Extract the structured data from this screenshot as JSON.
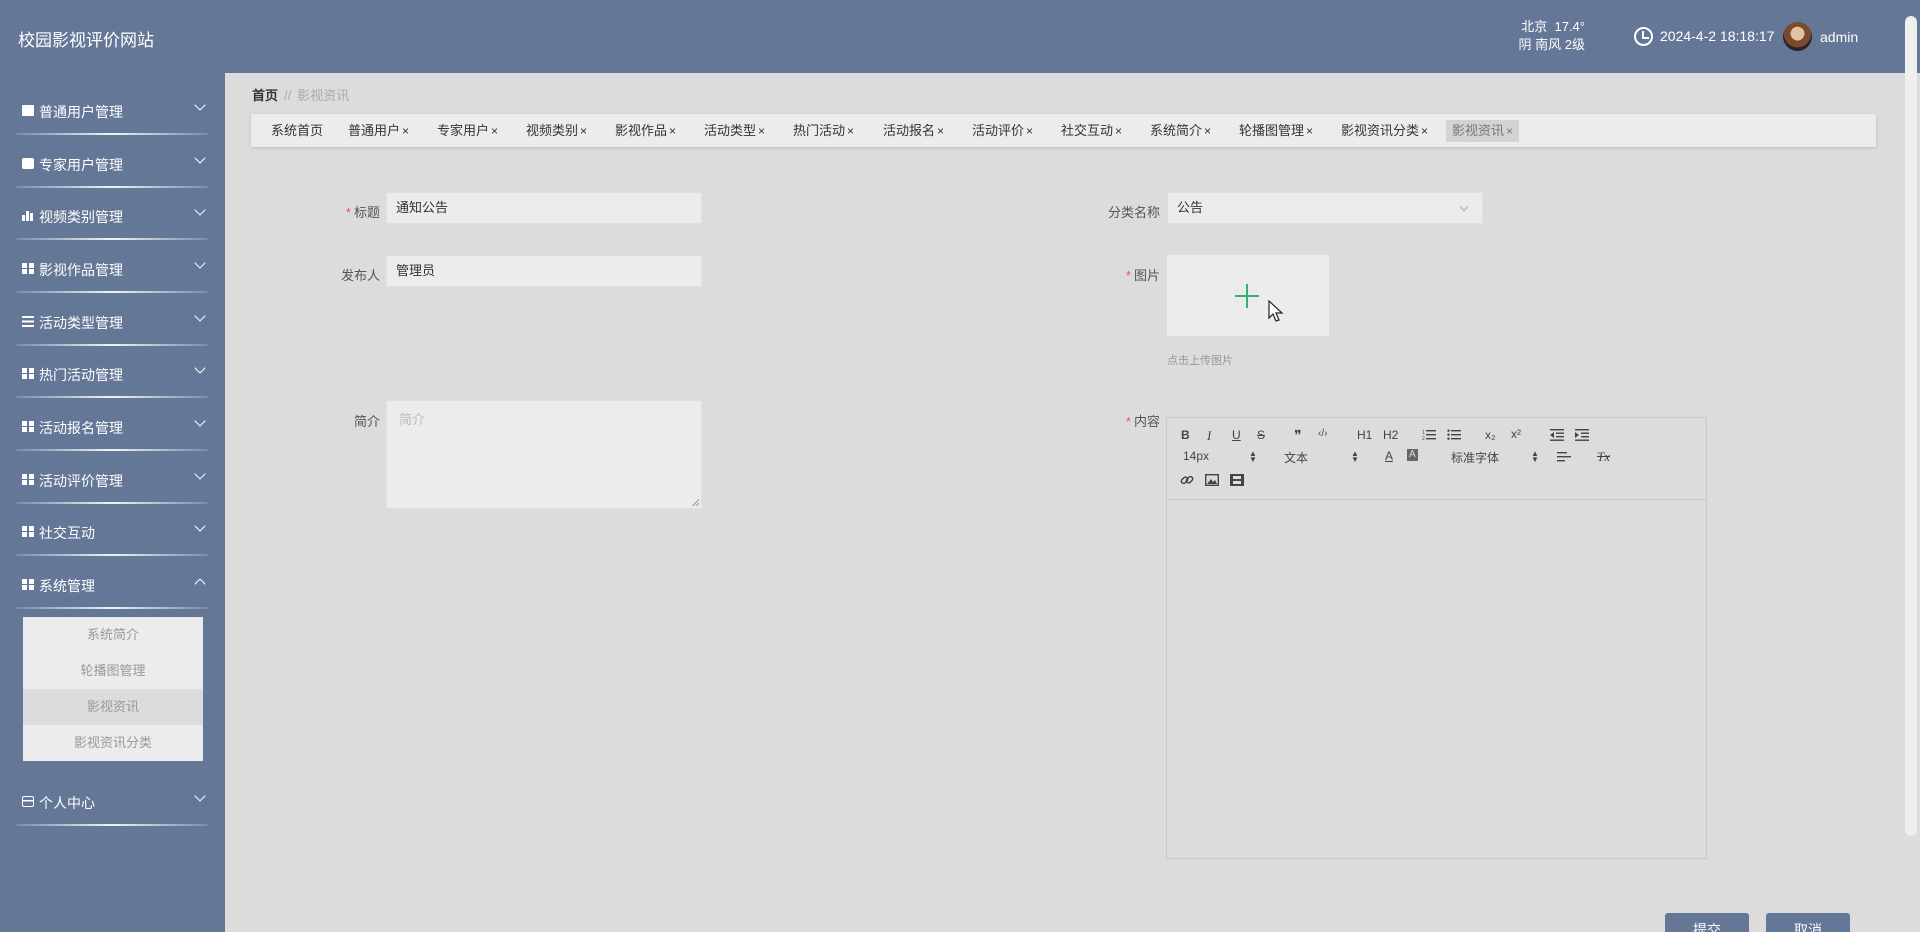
{
  "header": {
    "app_title": "校园影视评价网站",
    "weather": {
      "city": "北京",
      "temp": "17.4°",
      "desc": "阴 南风 2级"
    },
    "datetime": "2024-4-2 18:18:17",
    "user": "admin"
  },
  "sidebar": {
    "items": [
      {
        "label": "普通用户管理",
        "icon": "clipboard-icon"
      },
      {
        "label": "专家用户管理",
        "icon": "briefcase-icon"
      },
      {
        "label": "视频类别管理",
        "icon": "bar-chart-icon"
      },
      {
        "label": "影视作品管理",
        "icon": "grid-icon"
      },
      {
        "label": "活动类型管理",
        "icon": "list-icon"
      },
      {
        "label": "热门活动管理",
        "icon": "grid-icon"
      },
      {
        "label": "活动报名管理",
        "icon": "grid-icon"
      },
      {
        "label": "活动评价管理",
        "icon": "grid-icon"
      },
      {
        "label": "社交互动",
        "icon": "grid-icon"
      },
      {
        "label": "系统管理",
        "icon": "grid-icon",
        "expanded": true
      },
      {
        "label": "个人中心",
        "icon": "card-icon"
      }
    ],
    "submenu": [
      "系统简介",
      "轮播图管理",
      "影视资讯",
      "影视资讯分类"
    ],
    "active_submenu": "影视资讯"
  },
  "breadcrumb": {
    "home": "首页",
    "separator": "//",
    "current": "影视资讯"
  },
  "tabs": [
    {
      "label": "系统首页",
      "closable": false
    },
    {
      "label": "普通用户",
      "closable": true
    },
    {
      "label": "专家用户",
      "closable": true
    },
    {
      "label": "视频类别",
      "closable": true
    },
    {
      "label": "影视作品",
      "closable": true
    },
    {
      "label": "活动类型",
      "closable": true
    },
    {
      "label": "热门活动",
      "closable": true
    },
    {
      "label": "活动报名",
      "closable": true
    },
    {
      "label": "活动评价",
      "closable": true
    },
    {
      "label": "社交互动",
      "closable": true
    },
    {
      "label": "系统简介",
      "closable": true
    },
    {
      "label": "轮播图管理",
      "closable": true
    },
    {
      "label": "影视资讯分类",
      "closable": true
    },
    {
      "label": "影视资讯",
      "closable": true,
      "active": true
    }
  ],
  "tab_close_glyph": "×",
  "form": {
    "title": {
      "label": "标题",
      "value": "通知公告",
      "required": true
    },
    "category": {
      "label": "分类名称",
      "value": "公告"
    },
    "publisher": {
      "label": "发布人",
      "value": "管理员"
    },
    "image": {
      "label": "图片",
      "hint": "点击上传图片",
      "required": true
    },
    "summary": {
      "label": "简介",
      "placeholder": "简介"
    },
    "content": {
      "label": "内容",
      "required": true
    },
    "required_mark": "*"
  },
  "editor": {
    "toolbar_row1": [
      "B",
      "I",
      "U",
      "S",
      "❞",
      "‹/›",
      "H1",
      "H2",
      "ordered-list",
      "bullet-list",
      "x₂",
      "x²",
      "outdent",
      "indent"
    ],
    "font_size": "14px",
    "header_select": "文本",
    "text_color_glyph": "A",
    "font_family": "标准字体",
    "clean_glyph": "Tx"
  },
  "buttons": {
    "submit": "提交",
    "cancel": "取消"
  },
  "colors": {
    "primary": "#657796",
    "background": "#dcdcdc",
    "accent_green": "#2fb36f",
    "required_red": "#e55555"
  }
}
